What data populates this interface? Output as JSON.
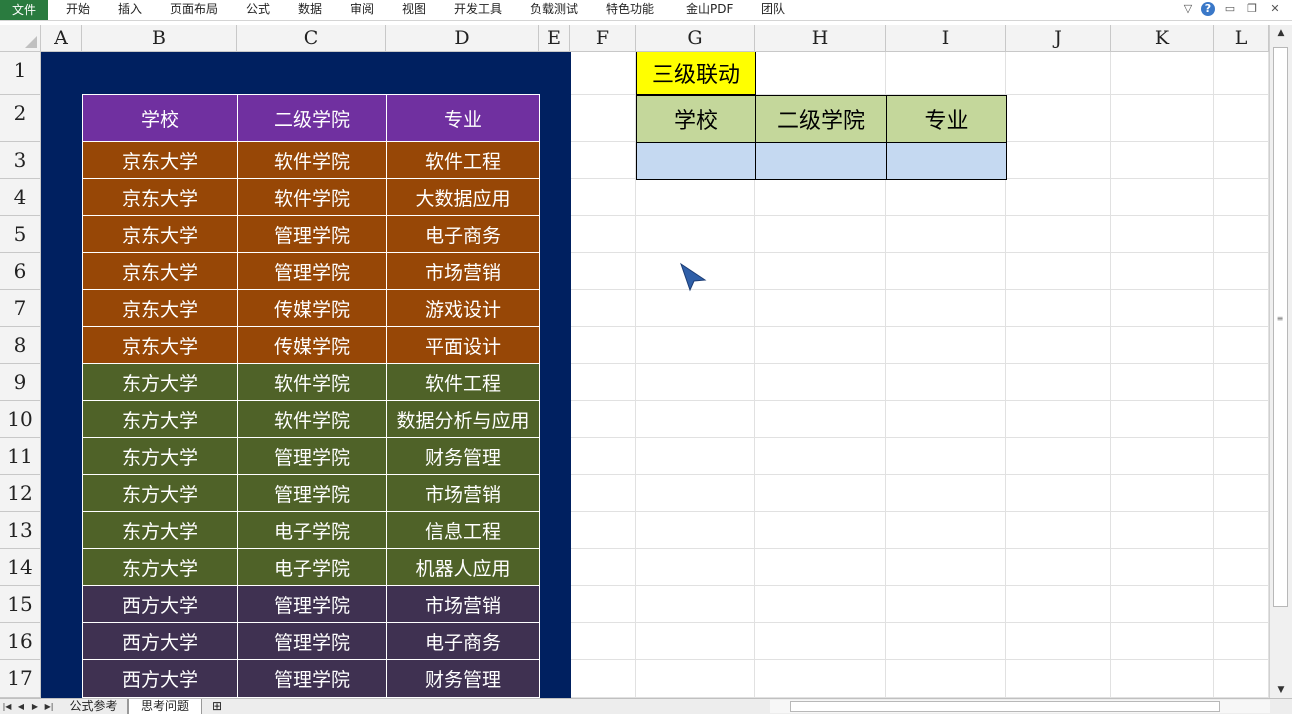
{
  "ribbon": {
    "file_label": "文件",
    "tabs": [
      "开始",
      "插入",
      "页面布局",
      "公式",
      "数据",
      "审阅",
      "视图",
      "开发工具",
      "负载测试",
      "特色功能",
      "金山PDF",
      "团队"
    ],
    "help_icon": "?"
  },
  "columns": [
    "A",
    "B",
    "C",
    "D",
    "E",
    "F",
    "G",
    "H",
    "I",
    "J",
    "K",
    "L"
  ],
  "rows": [
    "1",
    "2",
    "3",
    "4",
    "5",
    "6",
    "7",
    "8",
    "9",
    "10",
    "11",
    "12",
    "13",
    "14",
    "15",
    "16",
    "17"
  ],
  "left_table": {
    "headers": [
      "学校",
      "二级学院",
      "专业"
    ],
    "rows": [
      [
        "京东大学",
        "软件学院",
        "软件工程"
      ],
      [
        "京东大学",
        "软件学院",
        "大数据应用"
      ],
      [
        "京东大学",
        "管理学院",
        "电子商务"
      ],
      [
        "京东大学",
        "管理学院",
        "市场营销"
      ],
      [
        "京东大学",
        "传媒学院",
        "游戏设计"
      ],
      [
        "京东大学",
        "传媒学院",
        "平面设计"
      ],
      [
        "东方大学",
        "软件学院",
        "软件工程"
      ],
      [
        "东方大学",
        "软件学院",
        "数据分析与应用"
      ],
      [
        "东方大学",
        "管理学院",
        "财务管理"
      ],
      [
        "东方大学",
        "管理学院",
        "市场营销"
      ],
      [
        "东方大学",
        "电子学院",
        "信息工程"
      ],
      [
        "东方大学",
        "电子学院",
        "机器人应用"
      ],
      [
        "西方大学",
        "管理学院",
        "市场营销"
      ],
      [
        "西方大学",
        "管理学院",
        "电子商务"
      ],
      [
        "西方大学",
        "管理学院",
        "财务管理"
      ]
    ]
  },
  "right_table": {
    "title": "三级联动",
    "headers": [
      "学校",
      "二级学院",
      "专业"
    ],
    "inputs": [
      "",
      "",
      ""
    ]
  },
  "sheets": [
    "公式参考",
    "思考问题"
  ],
  "colors": {
    "navy_bg": "#002060",
    "header_purple": "#7030a0",
    "orange": "#974706",
    "green": "#4f6228",
    "dark_purple": "#3f3151",
    "title_yellow": "#ffff00",
    "header_green": "#c4d79b",
    "input_blue": "#c5d9f1"
  }
}
